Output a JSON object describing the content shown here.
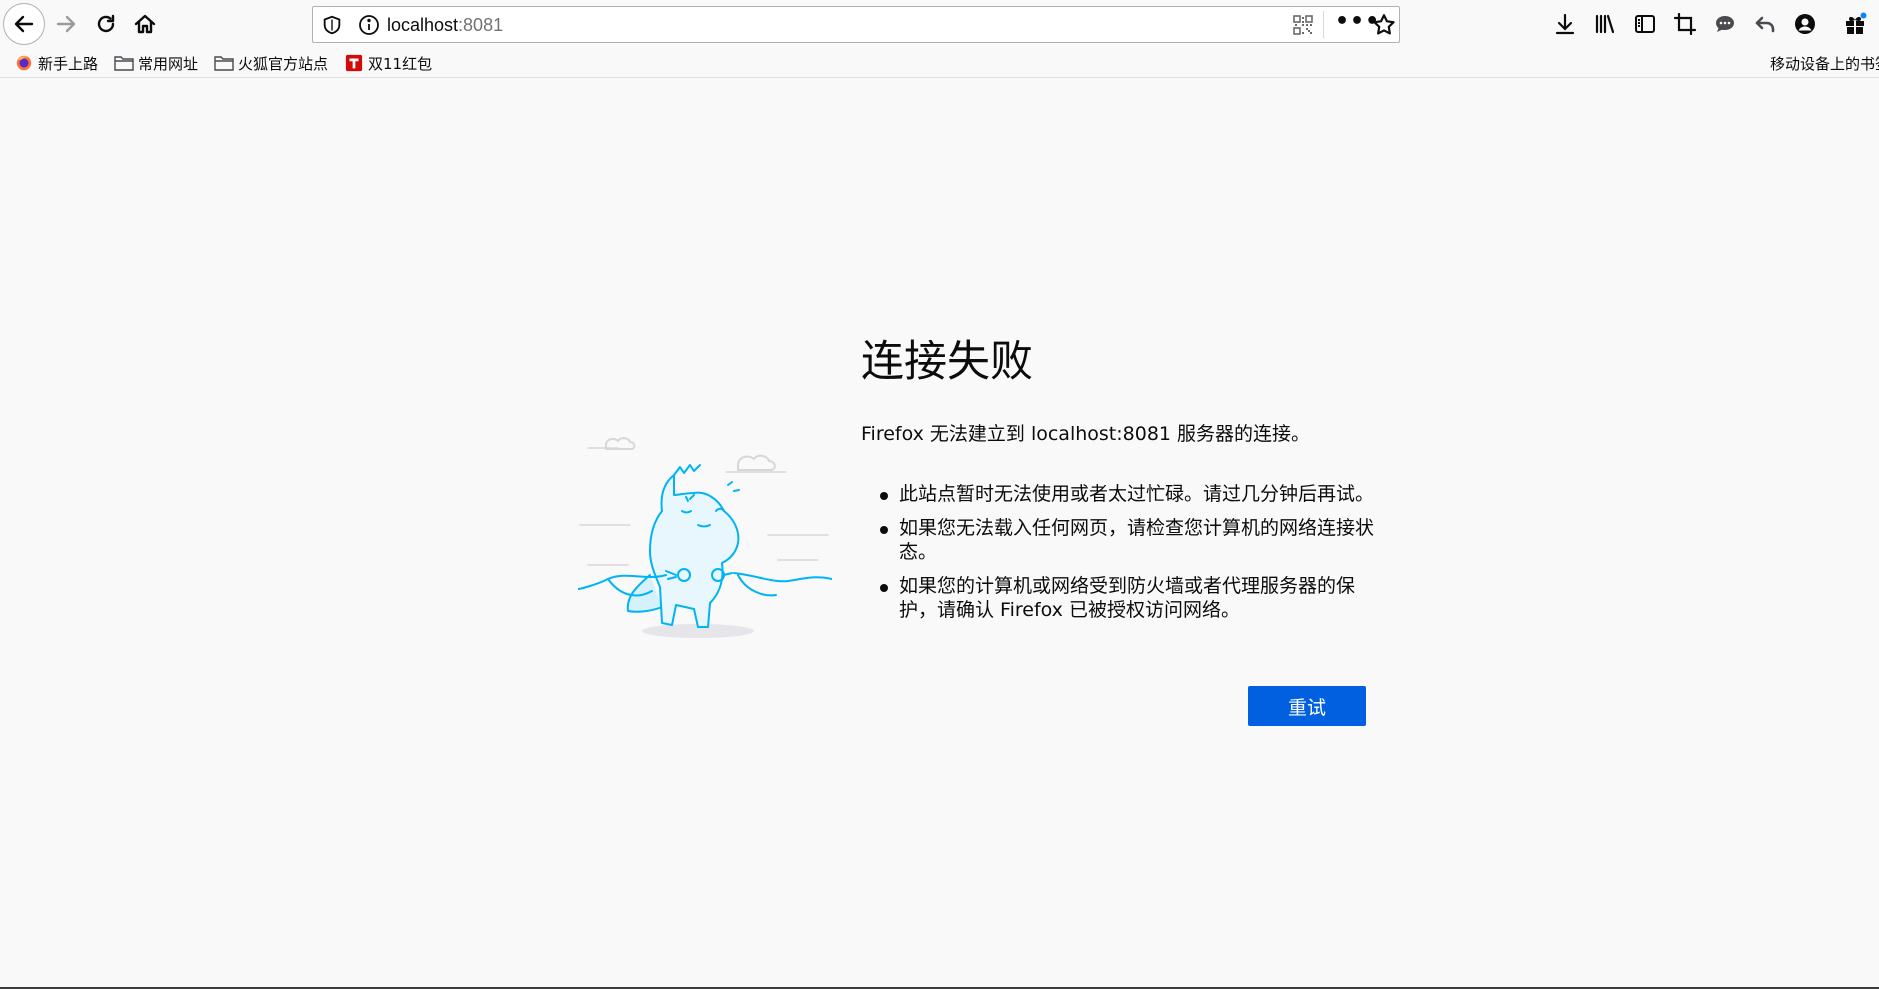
{
  "browser": {
    "url_host": "localhost",
    "url_port": ":8081",
    "more_label": "•••"
  },
  "bookmarks": [
    {
      "label": "新手上路",
      "icon": "firefox-icon"
    },
    {
      "label": "常用网址",
      "icon": "folder-icon"
    },
    {
      "label": "火狐官方站点",
      "icon": "folder-icon"
    },
    {
      "label": "双11红包",
      "icon": "tmall-icon"
    }
  ],
  "mobile_bookmarks": "移动设备上的书签",
  "error": {
    "title": "连接失败",
    "description": "Firefox 无法建立到 localhost:8081 服务器的连接。",
    "tips": [
      "此站点暂时无法使用或者太过忙碌。请过几分钟后再试。",
      "如果您无法载入任何网页，请检查您计算机的网络连接状态。",
      "如果您的计算机或网络受到防火墙或者代理服务器的保护，请确认 Firefox 已被授权访问网络。"
    ],
    "retry_label": "重试"
  },
  "colors": {
    "accent": "#0060df",
    "page_bg": "#f9f9fa",
    "illustration_stroke": "#00b3f4"
  }
}
